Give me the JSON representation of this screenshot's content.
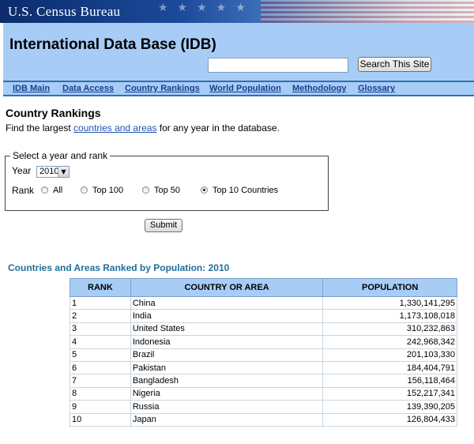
{
  "header": {
    "agency": "U.S. Census Bureau",
    "site_title": "International Data Base (IDB)",
    "search_value": "",
    "search_button": "Search This Site"
  },
  "nav": {
    "items": [
      "IDB Main",
      "Data Access",
      "Country Rankings",
      "World Population",
      "Methodology",
      "Glossary"
    ]
  },
  "page": {
    "heading": "Country Rankings",
    "intro_before": "Find the largest ",
    "intro_link": "countries and areas",
    "intro_after": " for any year in the database."
  },
  "form": {
    "legend": "Select a year and rank",
    "year_label": "Year",
    "year_value": "2010",
    "rank_label": "Rank",
    "options": [
      {
        "label": "All",
        "checked": false
      },
      {
        "label": "Top 100",
        "checked": false
      },
      {
        "label": "Top 50",
        "checked": false
      },
      {
        "label": "Top 10 Countries",
        "checked": true
      }
    ],
    "submit": "Submit"
  },
  "table": {
    "title": "Countries and Areas Ranked by Population: 2010",
    "columns": [
      "RANK",
      "COUNTRY OR AREA",
      "POPULATION"
    ],
    "rows": [
      [
        "1",
        "China",
        "1,330,141,295"
      ],
      [
        "2",
        "India",
        "1,173,108,018"
      ],
      [
        "3",
        "United States",
        "310,232,863"
      ],
      [
        "4",
        "Indonesia",
        "242,968,342"
      ],
      [
        "5",
        "Brazil",
        "201,103,330"
      ],
      [
        "6",
        "Pakistan",
        "184,404,791"
      ],
      [
        "7",
        "Bangladesh",
        "156,118,464"
      ],
      [
        "8",
        "Nigeria",
        "152,217,341"
      ],
      [
        "9",
        "Russia",
        "139,390,205"
      ],
      [
        "10",
        "Japan",
        "126,804,433"
      ]
    ]
  },
  "colors": {
    "header_bg": "#a7cdf7",
    "nav_link": "#1a3f8f",
    "table_title": "#1f6f9a",
    "banner": "#0b2c6b"
  }
}
